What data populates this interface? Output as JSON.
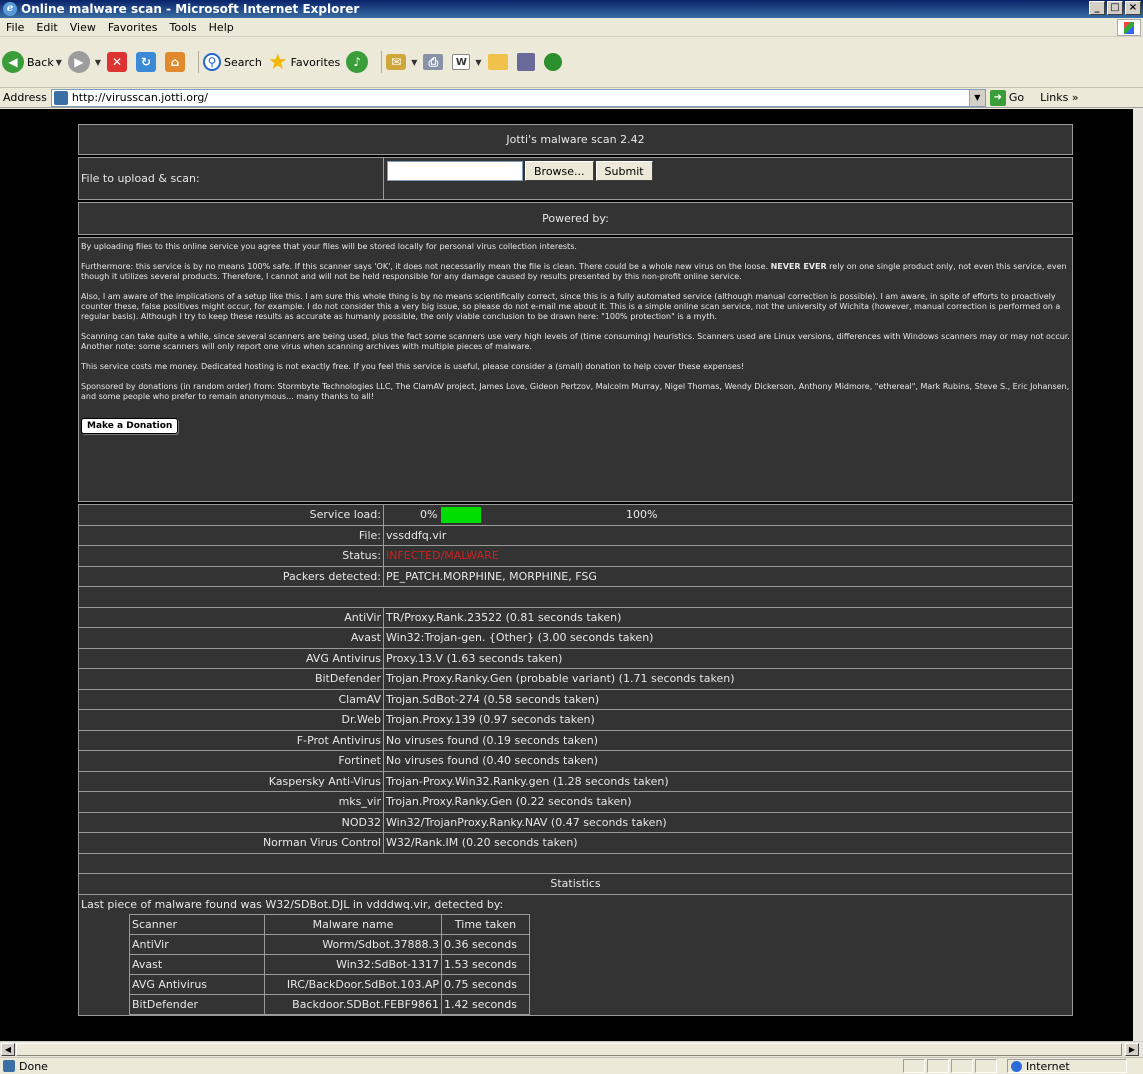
{
  "window": {
    "title": "Online malware scan - Microsoft Internet Explorer"
  },
  "menu": [
    "File",
    "Edit",
    "View",
    "Favorites",
    "Tools",
    "Help"
  ],
  "toolbar": {
    "back": "Back",
    "search": "Search",
    "favorites": "Favorites"
  },
  "address": {
    "label": "Address",
    "url": "http://virusscan.jotti.org/",
    "go": "Go",
    "links": "Links"
  },
  "page": {
    "header": "Jotti's malware scan 2.42",
    "upload_label": "File to upload & scan:",
    "browse": "Browse...",
    "submit": "Submit",
    "powered_by": "Powered by:",
    "disclaimer": [
      "By uploading files to this online service you agree that your files will be stored locally for personal virus collection interests.",
      "Also, I am aware of the implications of a setup like this. I am sure this whole thing is by no means scientifically correct, since this is a fully automated service (although manual correction is possible). I am aware, in spite of efforts to proactively counter these, false positives might occur, for example. I do not consider this a very big issue, so please do not e-mail me about it. This is a simple online scan service, not the university of Wichita (however, manual correction is performed on a regular basis). Although I try to keep these results as accurate as humanly possible, the only viable conclusion to be drawn here: \"100% protection\" is a myth.",
      "Scanning can take quite a while, since several scanners are being used, plus the fact some scanners use very high levels of (time consuming) heuristics. Scanners used are Linux versions, differences with Windows scanners may or may not occur. Another note: some scanners will only report one virus when scanning archives with multiple pieces of malware.",
      "This service costs me money. Dedicated hosting is not exactly free. If you feel this service is useful, please consider a (small) donation to help cover these expenses!",
      "Sponsored by donations (in random order) from: Stormbyte Technologies LLC, The ClamAV project, James Love, Gideon Pertzov, Malcolm Murray, Nigel Thomas, Wendy Dickerson, Anthony Midmore, \"ethereal\", Mark Rubins, Steve S., Eric Johansen, and some people who prefer to remain anonymous... many thanks to all!"
    ],
    "disclaimer_p2_a": "Furthermore: this service is by no means 100% safe. If this scanner says 'OK', it does not necessarily mean the file is clean. There could be a whole new virus on the loose.",
    "disclaimer_p2_bold": "NEVER EVER",
    "disclaimer_p2_b": "rely on one single product only, not even this service, even though it utilizes several products. Therefore, I cannot and will not be held responsible for any damage caused by results presented by this non-profit online service.",
    "donate": "Make a Donation",
    "service_load_label": "Service load:",
    "service_load_min": "0%",
    "service_load_max": "100%",
    "service_load_fraction": 0.1,
    "file_label": "File:",
    "file": "vssddfq.vir",
    "status_label": "Status:",
    "status": "INFECTED/MALWARE",
    "packers_label": "Packers detected:",
    "packers": "PE_PATCH.MORPHINE, MORPHINE, FSG",
    "results": [
      {
        "scanner": "AntiVir",
        "result": "TR/Proxy.Rank.23522 (0.81 seconds taken)"
      },
      {
        "scanner": "Avast",
        "result": "Win32:Trojan-gen. {Other} (3.00 seconds taken)"
      },
      {
        "scanner": "AVG Antivirus",
        "result": "Proxy.13.V (1.63 seconds taken)"
      },
      {
        "scanner": "BitDefender",
        "result": "Trojan.Proxy.Ranky.Gen (probable variant) (1.71 seconds taken)"
      },
      {
        "scanner": "ClamAV",
        "result": "Trojan.SdBot-274 (0.58 seconds taken)"
      },
      {
        "scanner": "Dr.Web",
        "result": "Trojan.Proxy.139 (0.97 seconds taken)"
      },
      {
        "scanner": "F-Prot Antivirus",
        "result": "No viruses found (0.19 seconds taken)"
      },
      {
        "scanner": "Fortinet",
        "result": "No viruses found (0.40 seconds taken)"
      },
      {
        "scanner": "Kaspersky Anti-Virus",
        "result": "Trojan-Proxy.Win32.Ranky.gen (1.28 seconds taken)"
      },
      {
        "scanner": "mks_vir",
        "result": "Trojan.Proxy.Ranky.Gen (0.22 seconds taken)"
      },
      {
        "scanner": "NOD32",
        "result": "Win32/TrojanProxy.Ranky.NAV (0.47 seconds taken)"
      },
      {
        "scanner": "Norman Virus Control",
        "result": "W32/Rank.IM (0.20 seconds taken)"
      }
    ],
    "statistics_title": "Statistics",
    "last_piece": "Last piece of malware found was W32/SDBot.DJL in vdddwq.vir, detected by:",
    "stats_headers": [
      "Scanner",
      "Malware name",
      "Time taken"
    ],
    "stats_rows": [
      {
        "scanner": "AntiVir",
        "malware": "Worm/Sdbot.37888.3",
        "time": "0.36 seconds"
      },
      {
        "scanner": "Avast",
        "malware": "Win32:SdBot-1317",
        "time": "1.53 seconds"
      },
      {
        "scanner": "AVG Antivirus",
        "malware": "IRC/BackDoor.SdBot.103.AP",
        "time": "0.75 seconds"
      },
      {
        "scanner": "BitDefender",
        "malware": "Backdoor.SDBot.FEBF9861",
        "time": "1.42 seconds"
      }
    ]
  },
  "status_bar": {
    "text": "Done",
    "zone": "Internet"
  },
  "colors": {
    "page_bg": "#000000",
    "panel_bg": "#333333",
    "infected": "#cc2222",
    "load_bar": "#00dd00"
  }
}
